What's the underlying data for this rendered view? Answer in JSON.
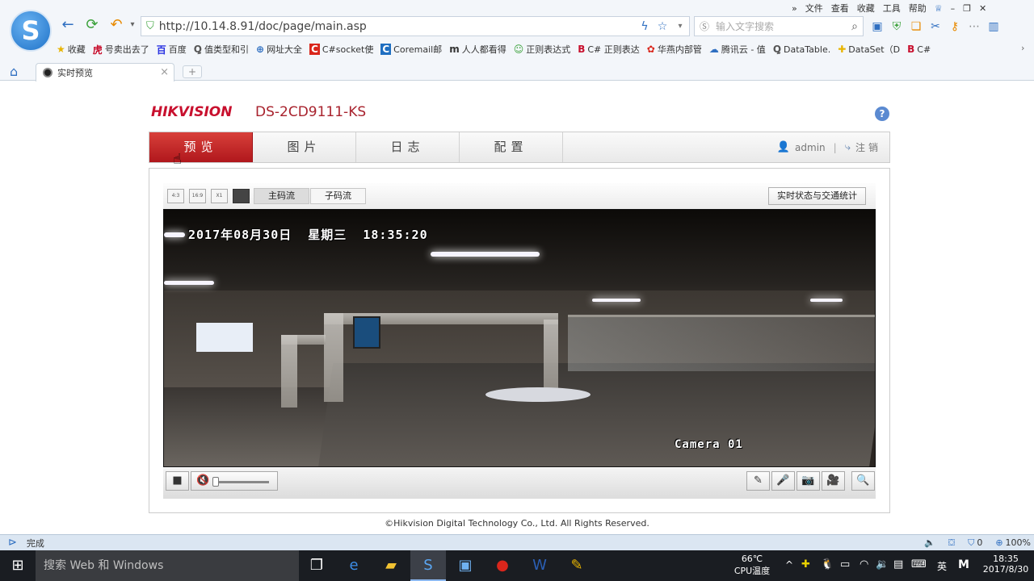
{
  "browser": {
    "menu": [
      "»",
      "文件",
      "查看",
      "收藏",
      "工具",
      "帮助"
    ],
    "address": "http://10.14.8.91/doc/page/main.asp",
    "search_placeholder": "输入文字搜索",
    "favorites": [
      {
        "icon": "★",
        "label": "收藏",
        "color": "#e8b400"
      },
      {
        "icon": "虎",
        "label": "号卖出去了",
        "color": "#c8102e"
      },
      {
        "icon": "百",
        "label": "百度",
        "color": "#2932e1"
      },
      {
        "icon": "Ꝗ",
        "label": "值类型和引",
        "color": "#555555"
      },
      {
        "icon": "⊕",
        "label": "网址大全",
        "color": "#2f6fc1"
      },
      {
        "icon": "C",
        "label": "C#socket使",
        "color": "#d9261c"
      },
      {
        "icon": "C",
        "label": "Coremail邮",
        "color": "#1f6fc1"
      },
      {
        "icon": "m",
        "label": "人人都看得",
        "color": "#333333"
      },
      {
        "icon": "☺",
        "label": "正则表达式",
        "color": "#3aa13a"
      },
      {
        "icon": "B",
        "label": "C# 正则表达",
        "color": "#c8102e"
      },
      {
        "icon": "✿",
        "label": "华燕内部管",
        "color": "#d9261c"
      },
      {
        "icon": "☁",
        "label": "腾讯云 - 值",
        "color": "#2f6fc1"
      },
      {
        "icon": "Ꝗ",
        "label": "DataTable.",
        "color": "#555555"
      },
      {
        "icon": "✚",
        "label": "DataSet（D",
        "color": "#e8b400"
      },
      {
        "icon": "B",
        "label": "C#",
        "color": "#c8102e"
      }
    ],
    "tab_title": "实时预览",
    "status_text": "完成",
    "zoom": "100%",
    "counter": "0"
  },
  "app": {
    "brand": "HIKVISION",
    "model": "DS-2CD9111-KS",
    "help": "?",
    "nav": [
      "预览",
      "图片",
      "日志",
      "配置"
    ],
    "user": "admin",
    "separator": "|",
    "logout": "注销",
    "ratios": [
      "4:3",
      "16:9",
      "X1",
      ""
    ],
    "streams": [
      "主码流",
      "子码流"
    ],
    "status_button": "实时状态与交通统计",
    "osd_datetime": "2017年08月30日  星期三  18:35:20",
    "osd_camera": "Camera 01",
    "volume_level": 0.0,
    "footer": "©Hikvision Digital Technology Co., Ltd. All Rights Reserved."
  },
  "taskbar": {
    "search": "搜索 Web 和 Windows",
    "temp_value": "66℃",
    "temp_label": "CPU温度",
    "ime": "英",
    "ime2": "M",
    "time": "18:35",
    "date": "2017/8/30"
  },
  "colors": {
    "accent": "#c8102e",
    "nav_active": "#c8201f",
    "taskbar": "#1a1d22"
  }
}
